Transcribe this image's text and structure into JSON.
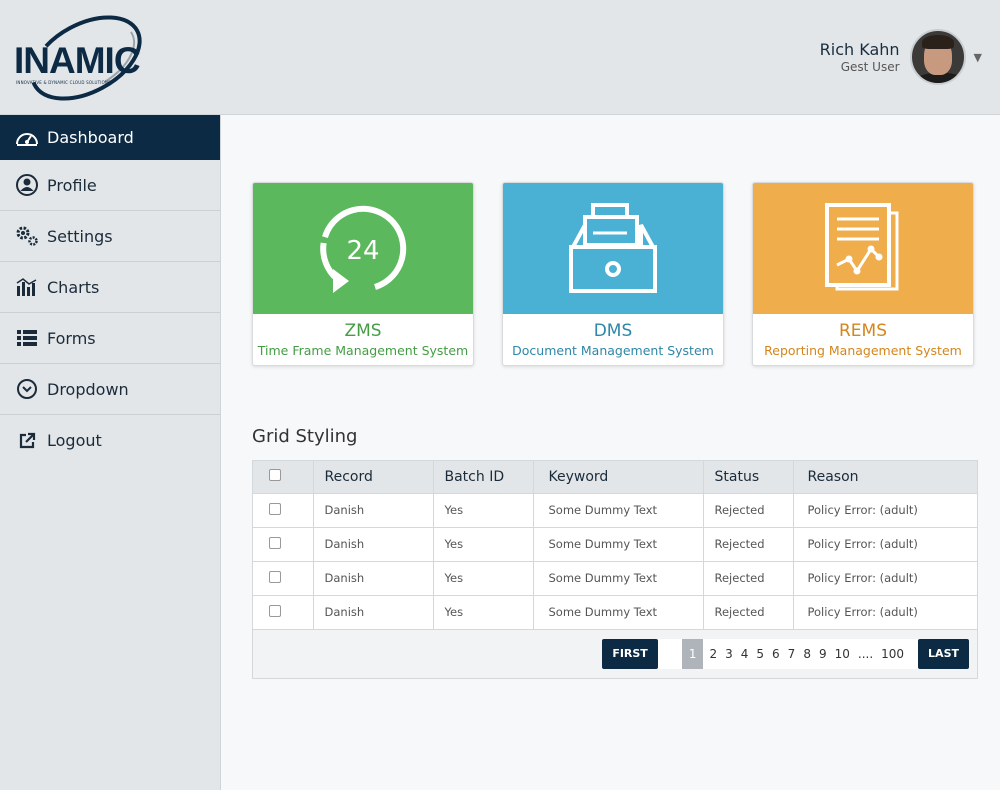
{
  "brand": {
    "name": "INAMIC",
    "tagline": "INNOVATIVE & DYNAMIC CLOUD SOLUTIONS"
  },
  "user": {
    "name": "Rich Kahn",
    "role": "Gest User"
  },
  "sidebar": {
    "items": [
      {
        "label": "Dashboard",
        "icon": "dashboard-gauge-icon",
        "active": true
      },
      {
        "label": "Profile",
        "icon": "user-icon"
      },
      {
        "label": "Settings",
        "icon": "gears-icon"
      },
      {
        "label": "Charts",
        "icon": "bar-chart-icon"
      },
      {
        "label": "Forms",
        "icon": "list-icon"
      },
      {
        "label": "Dropdown",
        "icon": "chevron-circle-down-icon"
      },
      {
        "label": "Logout",
        "icon": "external-link-icon"
      }
    ]
  },
  "cards": [
    {
      "code": "ZMS",
      "title": "Time Frame Management System",
      "color": "#5cb85c",
      "icon": "24-hours-icon",
      "badge": "24"
    },
    {
      "code": "DMS",
      "title": "Document Management System",
      "color": "#4bb1d4",
      "icon": "archive-drawer-icon"
    },
    {
      "code": "REMS",
      "title": "Reporting Management System",
      "color": "#efad4c",
      "icon": "report-chart-icon"
    }
  ],
  "grid": {
    "title": "Grid Styling",
    "columns": [
      "Record",
      "Batch ID",
      "Keyword",
      "Status",
      "Reason"
    ],
    "rows": [
      [
        "Danish",
        "Yes",
        "Some Dummy Text",
        "Rejected",
        "Policy Error: (adult)"
      ],
      [
        "Danish",
        "Yes",
        "Some Dummy Text",
        "Rejected",
        "Policy Error: (adult)"
      ],
      [
        "Danish",
        "Yes",
        "Some Dummy Text",
        "Rejected",
        "Policy Error: (adult)"
      ],
      [
        "Danish",
        "Yes",
        "Some Dummy Text",
        "Rejected",
        "Policy Error: (adult)"
      ]
    ]
  },
  "pager": {
    "first": "FIRST",
    "last": "LAST",
    "pages": [
      "1",
      "2",
      "3",
      "4",
      "5",
      "6",
      "7",
      "8",
      "9",
      "10",
      "....",
      "100"
    ],
    "current": "1"
  }
}
